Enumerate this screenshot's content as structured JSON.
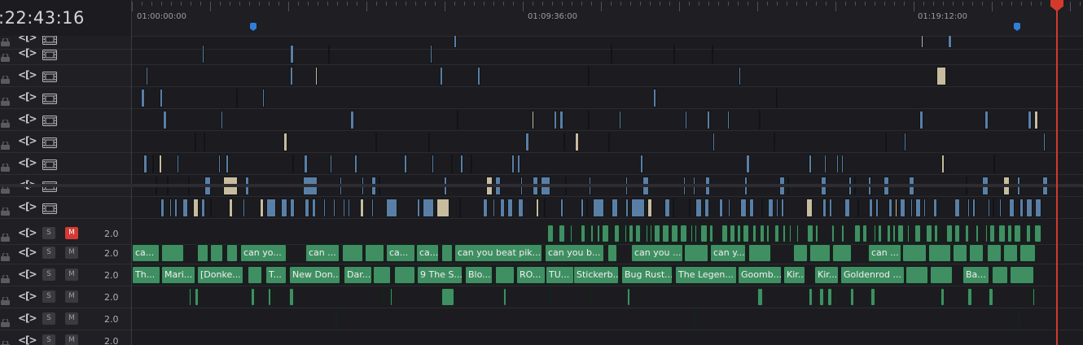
{
  "timecode": ":22:43:16",
  "ruler": {
    "labels": [
      "01:00:00:00",
      "01:09:36:00",
      "01:19:12:00"
    ]
  },
  "colors": {
    "video_clip": "#5a7fa6",
    "cream_clip": "#c8bc9e",
    "audio_clip": "#3f8f62",
    "playhead": "#d33a2c",
    "marker": "#2f7fd9"
  },
  "video_tracks": [
    {
      "lock_icon": "lock-icon",
      "link_icon": "link-icon",
      "type_icon": "film-icon"
    },
    {
      "lock_icon": "lock-icon",
      "link_icon": "link-icon",
      "type_icon": "film-icon"
    },
    {
      "lock_icon": "lock-icon",
      "link_icon": "link-icon",
      "type_icon": "film-icon"
    },
    {
      "lock_icon": "lock-icon",
      "link_icon": "link-icon",
      "type_icon": "film-icon"
    },
    {
      "lock_icon": "lock-icon",
      "link_icon": "link-icon",
      "type_icon": "film-icon"
    },
    {
      "lock_icon": "lock-icon",
      "link_icon": "link-icon",
      "type_icon": "film-icon"
    },
    {
      "lock_icon": "lock-icon",
      "link_icon": "link-icon",
      "type_icon": "film-icon"
    },
    {
      "lock_icon": "lock-icon",
      "link_icon": "link-icon",
      "type_icon": "film-icon"
    },
    {
      "lock_icon": "lock-icon",
      "link_icon": "link-icon",
      "type_icon": "film-icon"
    }
  ],
  "audio_tracks": [
    {
      "solo": "S",
      "mute": "M",
      "mute_active": true,
      "volume": "2.0"
    },
    {
      "solo": "S",
      "mute": "M",
      "mute_active": false,
      "volume": "2.0"
    },
    {
      "solo": "S",
      "mute": "M",
      "mute_active": false,
      "volume": "2.0"
    },
    {
      "solo": "S",
      "mute": "M",
      "mute_active": false,
      "volume": "2.0"
    },
    {
      "solo": "S",
      "mute": "M",
      "mute_active": false,
      "volume": "2.0"
    },
    {
      "solo": "S",
      "mute": "M",
      "mute_active": false,
      "volume": "2.0"
    }
  ],
  "audio_clip_labels": {
    "track_a2": [
      "ca...",
      "can yo...",
      "can ...",
      "ca...",
      "ca...",
      "can you beat pik...",
      "can you b...",
      "can you ...",
      "can y...",
      "can ..."
    ],
    "track_a3": [
      "Th...",
      "Mari...",
      "[Donke...",
      "T...",
      "New Don...",
      "Dar...",
      "9 The S...",
      "Blo...",
      "RO...",
      "TU...",
      "Stickerb...",
      "Bug Rust....",
      "The Legen...",
      "Goomb...",
      "Kir...",
      "Kir...",
      "Goldenrod ...",
      "Ba..."
    ]
  }
}
